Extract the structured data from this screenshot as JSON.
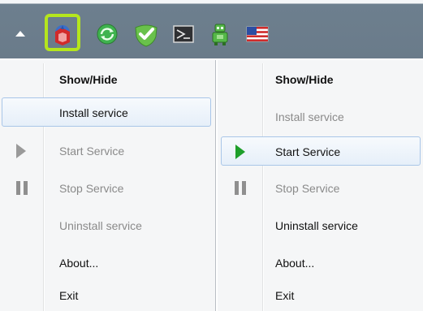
{
  "tray": {
    "icons": [
      "tray-overflow-arrow-icon",
      "service-app-icon",
      "sync-icon",
      "checkmark-shield-icon",
      "console-window-icon",
      "network-robot-icon",
      "us-flag-icon"
    ],
    "highlight_color": "#b5e61d"
  },
  "menu_left": {
    "items": [
      {
        "label": "Show/Hide",
        "state": "bold"
      },
      {
        "label": "Install service",
        "state": "hovered"
      },
      {
        "label": "Start Service",
        "state": "disabled",
        "icon": "play-icon"
      },
      {
        "label": "Stop Service",
        "state": "disabled",
        "icon": "pause-icon"
      },
      {
        "label": "Uninstall service",
        "state": "disabled"
      },
      {
        "label": "About...",
        "state": "normal"
      },
      {
        "label": "Exit",
        "state": "normal"
      }
    ]
  },
  "menu_right": {
    "items": [
      {
        "label": "Show/Hide",
        "state": "bold"
      },
      {
        "label": "Install service",
        "state": "disabled"
      },
      {
        "label": "Start Service",
        "state": "hovered",
        "icon": "play-icon"
      },
      {
        "label": "Stop Service",
        "state": "disabled",
        "icon": "pause-icon"
      },
      {
        "label": "Uninstall service",
        "state": "normal"
      },
      {
        "label": "About...",
        "state": "normal"
      },
      {
        "label": "Exit",
        "state": "normal"
      }
    ]
  },
  "colors": {
    "hover_border": "#a9c6e8",
    "play_enabled": "#1e9f2a",
    "disabled_text": "#8a8a8a"
  }
}
